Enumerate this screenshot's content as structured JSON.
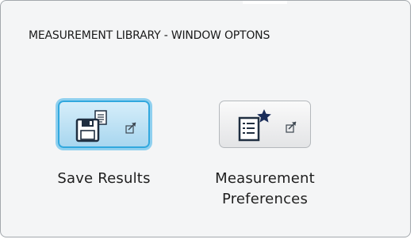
{
  "panel": {
    "title": "MEASUREMENT LIBRARY - WINDOW OPTONS"
  },
  "tiles": [
    {
      "label": "Save Results",
      "icon": "save-results-icon",
      "overlay_icon": "popout-arrow-icon",
      "selected": true
    },
    {
      "label_line1": "Measurement",
      "label_line2": "Preferences",
      "icon": "measurement-preferences-icon",
      "overlay_icon": "popout-arrow-icon",
      "selected": false
    }
  ],
  "colors": {
    "selected_border": "#31a8de",
    "selected_fill": "#a8d6ef",
    "icon_dark": "#1f2e40",
    "star": "#1a2d5a"
  }
}
